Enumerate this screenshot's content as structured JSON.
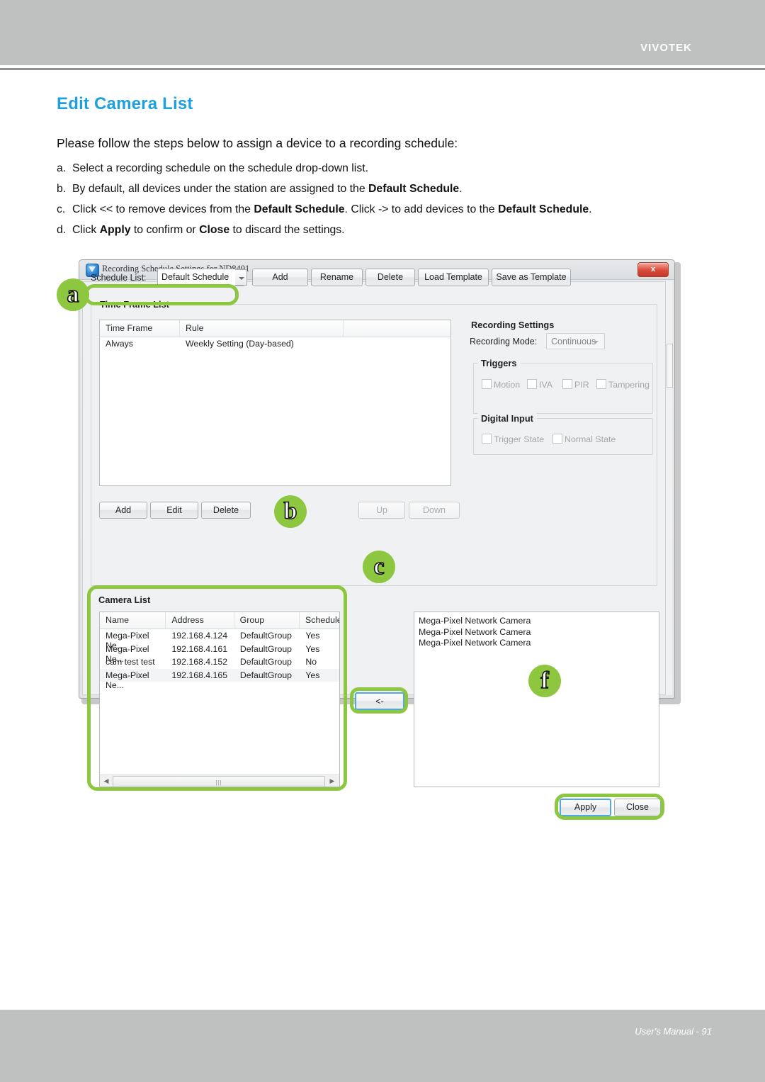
{
  "header": {
    "brand": "VIVOTEK"
  },
  "footer": {
    "text": "User's Manual - 91"
  },
  "page": {
    "title": "Edit Camera List",
    "intro": "Please follow the steps below to assign a device to a recording schedule:",
    "steps": [
      {
        "marker": "a.",
        "html": "Select a recording schedule on the schedule drop-down list."
      },
      {
        "marker": "b.",
        "html": "By default, all devices under the station are assigned to the <b>Default Schedule</b>."
      },
      {
        "marker": "c.",
        "html": "Click &lt;&lt; to remove devices from the <b>Default Schedule</b>. Click -&gt; to add devices to the <b>Default Schedule</b>."
      },
      {
        "marker": "d.",
        "html": "Click <b>Apply</b> to confirm or <b>Close</b> to discard the settings."
      }
    ]
  },
  "dialog": {
    "title": "Recording Schedule Settings for ND8401",
    "close_label": "x",
    "toolbar": {
      "schedule_list_label": "Schedule List:",
      "schedule_selected": "Default Schedule",
      "add_label": "Add",
      "rename_label": "Rename",
      "delete_label": "Delete",
      "load_template_label": "Load Template",
      "save_template_label": "Save as Template"
    },
    "time_frame_list": {
      "group_title": "Time Frame List",
      "columns": [
        "Time Frame",
        "Rule",
        ""
      ],
      "rows": [
        {
          "time_frame": "Always",
          "rule": "Weekly Setting (Day-based)",
          "extra": ""
        }
      ],
      "add_label": "Add",
      "edit_label": "Edit",
      "delete_label": "Delete",
      "up_label": "Up",
      "down_label": "Down"
    },
    "recording_settings": {
      "group_title": "Recording Settings",
      "recording_mode_label": "Recording Mode:",
      "recording_mode_value": "Continuous",
      "triggers": {
        "group_title": "Triggers",
        "items": [
          {
            "label": "Motion",
            "checked": false
          },
          {
            "label": "IVA",
            "checked": false
          },
          {
            "label": "PIR",
            "checked": false
          },
          {
            "label": "Tampering",
            "checked": false
          }
        ]
      },
      "digital_input": {
        "group_title": "Digital Input",
        "items": [
          {
            "label": "Trigger State",
            "checked": false
          },
          {
            "label": "Normal State",
            "checked": false
          }
        ]
      }
    },
    "camera_list": {
      "group_title": "Camera List",
      "columns": [
        "Name",
        "Address",
        "Group",
        "Schedule"
      ],
      "rows": [
        {
          "name": "Mega-Pixel Ne...",
          "address": "192.168.4.124",
          "group": "DefaultGroup",
          "schedule": "Yes"
        },
        {
          "name": "Mega-Pixel Ne...",
          "address": "192.168.4.161",
          "group": "DefaultGroup",
          "schedule": "Yes"
        },
        {
          "name": "cam test test",
          "address": "192.168.4.152",
          "group": "DefaultGroup",
          "schedule": "No"
        },
        {
          "name": "Mega-Pixel Ne...",
          "address": "192.168.4.165",
          "group": "DefaultGroup",
          "schedule": "Yes"
        }
      ]
    },
    "transfer_button_label": "<-",
    "assigned_list": [
      "Mega-Pixel Network Camera",
      "Mega-Pixel Network Camera",
      "Mega-Pixel Network Camera"
    ],
    "apply_label": "Apply",
    "close_button_label": "Close"
  },
  "callouts": {
    "a": "a",
    "b": "b",
    "c": "c",
    "f": "f"
  },
  "colors": {
    "accent": "#8dc63f",
    "title": "#1f9fe0",
    "band": "#bfc1c0"
  }
}
